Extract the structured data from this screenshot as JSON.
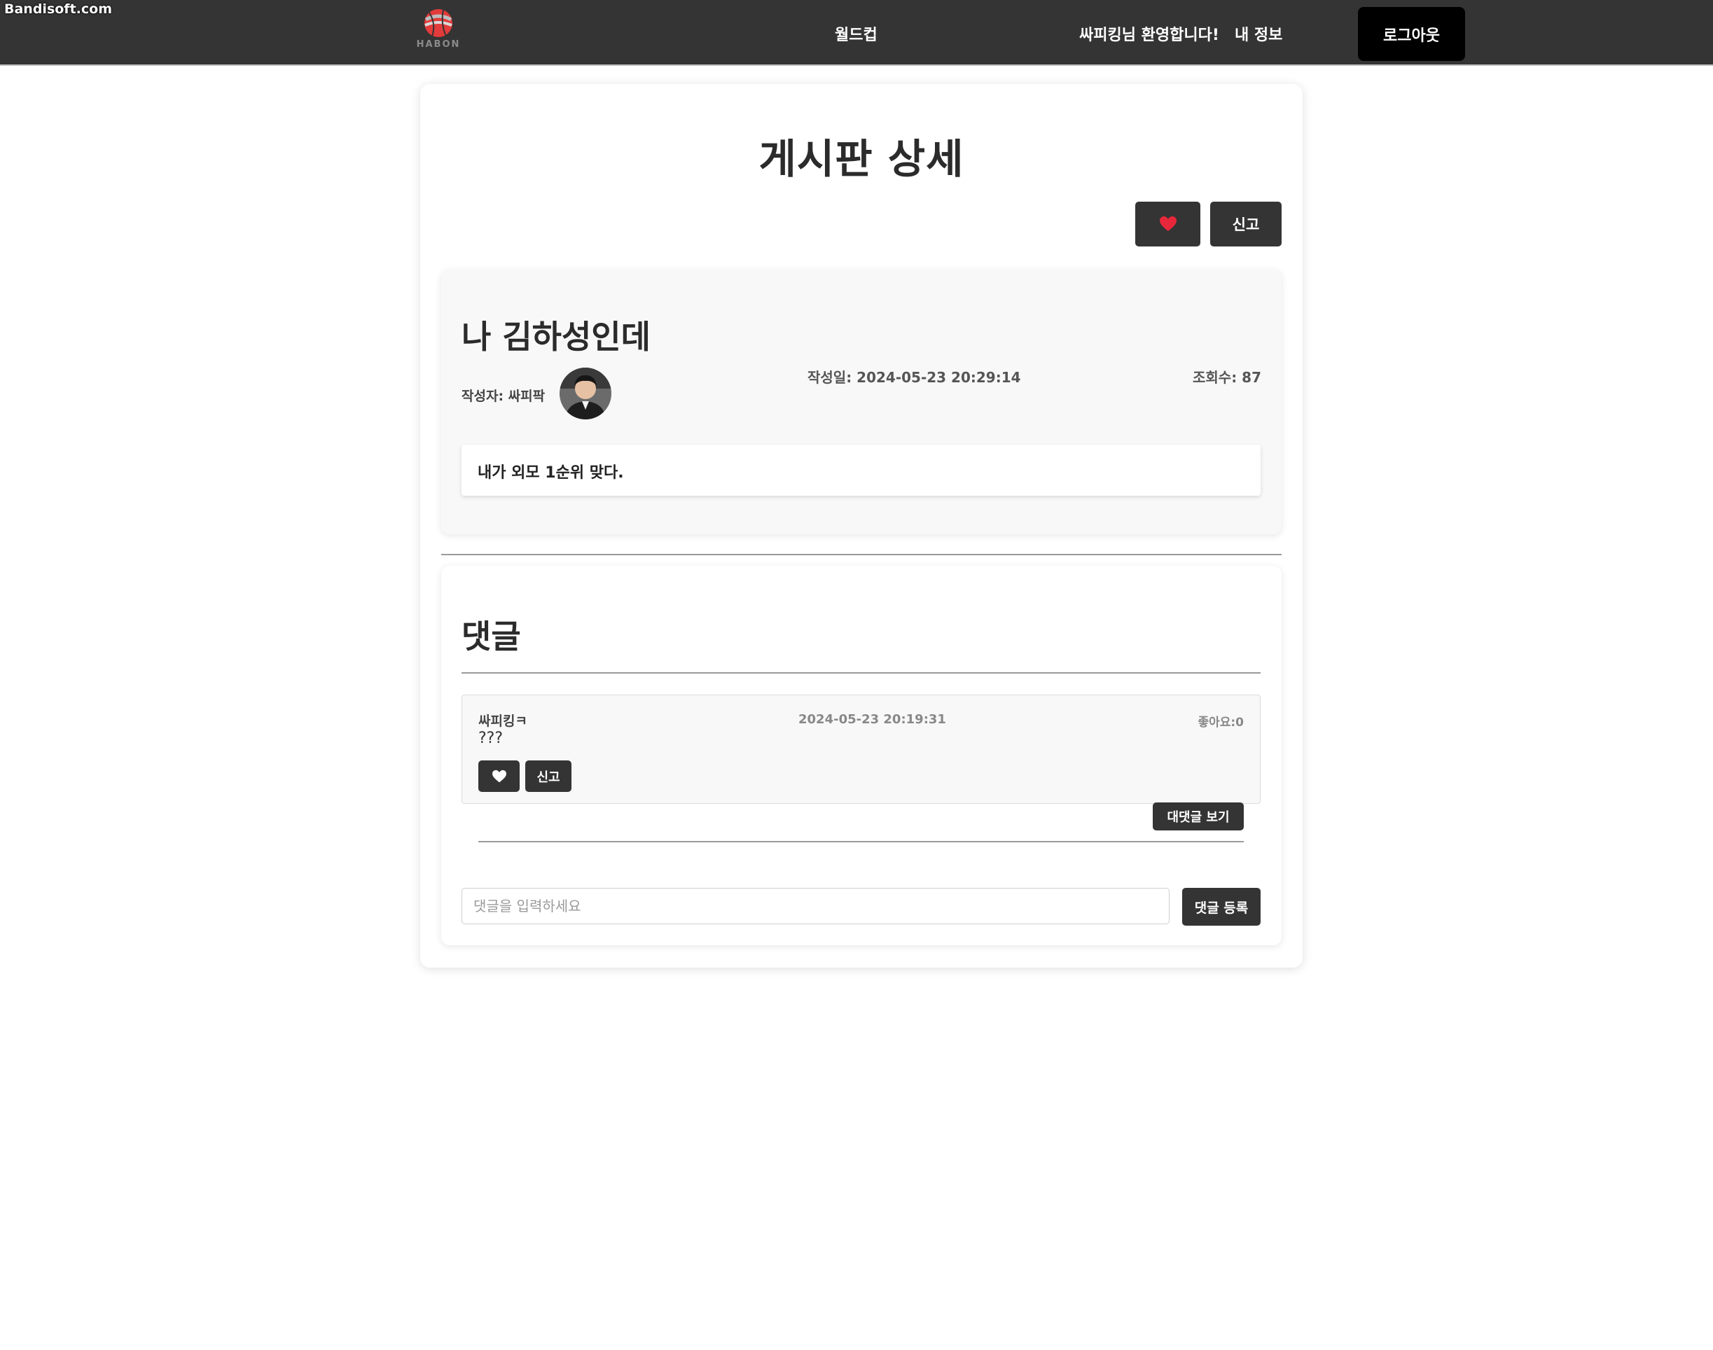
{
  "watermark": "Bandisoft.com",
  "nav": {
    "logo_text": "HABON",
    "worldcup": "월드컵",
    "welcome": "싸피킹님 환영합니다!",
    "my_info": "내 정보",
    "logout": "로그아웃"
  },
  "page": {
    "title": "게시판 상세",
    "report_label": "신고"
  },
  "post": {
    "title": "나 김하성인데",
    "author_label": "작성자:",
    "author_name": "싸피팍",
    "date": "작성일: 2024-05-23 20:29:14",
    "views": "조회수: 87",
    "content": "내가 외모 1순위 맞다."
  },
  "comments": {
    "heading": "댓글",
    "items": [
      {
        "author": "싸피킹ㅋ",
        "text": "???",
        "date": "2024-05-23 20:19:31",
        "likes": "좋아요:0",
        "report_label": "신고",
        "view_replies_label": "대댓글 보기"
      }
    ],
    "input_placeholder": "댓글을 입력하세요",
    "submit_label": "댓글 등록"
  },
  "colors": {
    "navbar": "#343434",
    "button_dark": "#343434",
    "heart_red": "#e8283a",
    "logout": "#000000"
  },
  "icons": {
    "logo": "basketball-logo-icon",
    "like_filled": "heart-red-icon",
    "like_outline": "heart-white-icon"
  }
}
